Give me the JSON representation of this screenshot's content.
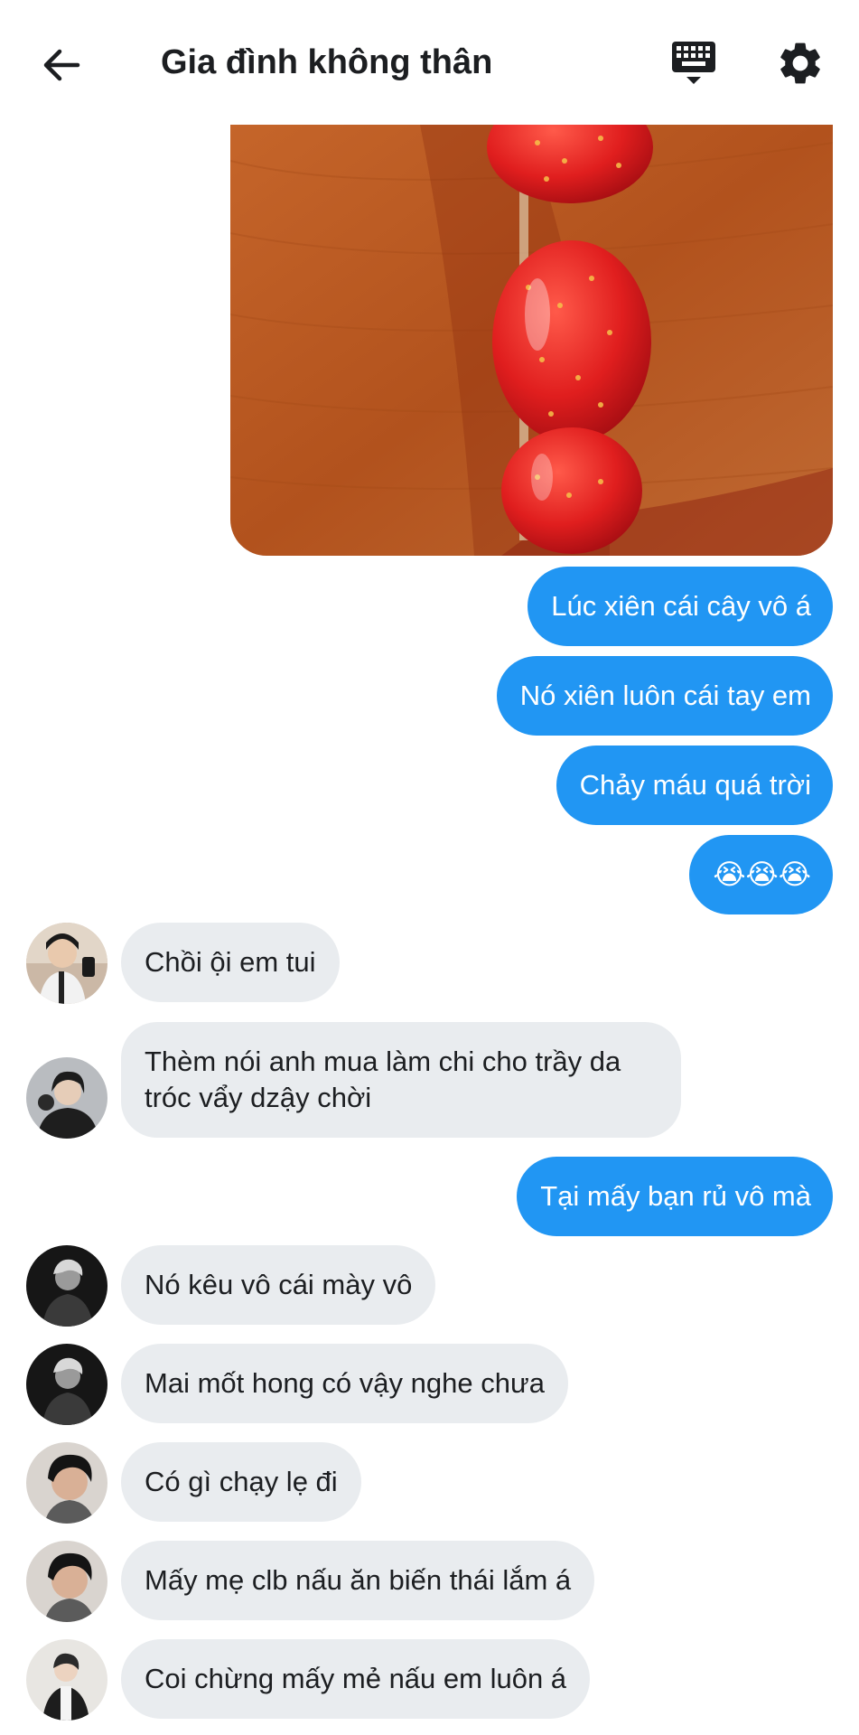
{
  "header": {
    "title": "Gia đình không thân"
  },
  "icons": {
    "back": "arrow-left-icon",
    "keyboard": "keyboard-icon",
    "settings": "gear-icon"
  },
  "colors": {
    "outgoing_bubble": "#2196f3",
    "incoming_bubble": "#e9ecef",
    "background": "#ffffff"
  },
  "messages": [
    {
      "direction": "out",
      "type": "image",
      "content": "strawberry skewer photo"
    },
    {
      "direction": "out",
      "text": "Lúc xiên cái cây vô á"
    },
    {
      "direction": "out",
      "text": "Nó xiên luôn cái tay em"
    },
    {
      "direction": "out",
      "text": "Chảy máu quá trời"
    },
    {
      "direction": "out",
      "text": "😭😭😭"
    },
    {
      "direction": "in",
      "text": "Chồi ội em tui"
    },
    {
      "direction": "in",
      "text": "Thèm nói anh mua làm chi cho trầy da tróc vẩy dzậy chời"
    },
    {
      "direction": "out",
      "text": "Tại mấy bạn rủ vô mà"
    },
    {
      "direction": "in",
      "text": "Nó kêu vô cái mày vô"
    },
    {
      "direction": "in",
      "text": "Mai mốt hong có vậy nghe chưa"
    },
    {
      "direction": "in",
      "text": "Có gì chạy lẹ đi"
    },
    {
      "direction": "in",
      "text": "Mấy mẹ clb nấu ăn biến thái lắm á"
    },
    {
      "direction": "in",
      "text": "Coi chừng mấy mẻ nấu em luôn á"
    }
  ]
}
